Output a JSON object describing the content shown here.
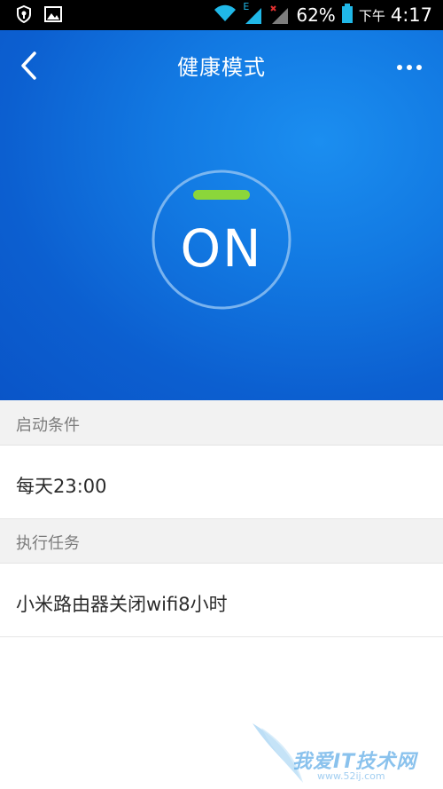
{
  "status_bar": {
    "battery": "62%",
    "period": "下午",
    "time": "4:17",
    "network_label": "E",
    "icons": [
      "shield-icon",
      "image-icon",
      "wifi-icon",
      "signal-icon",
      "signal-x-icon",
      "battery-icon"
    ]
  },
  "header": {
    "title": "健康模式",
    "back_icon": "chevron-left-icon",
    "more_icon": "more-horizontal-icon"
  },
  "toggle": {
    "state_label": "ON",
    "indicator_color": "#8bd63a"
  },
  "sections": [
    {
      "header": "启动条件",
      "item": "每天23:00"
    },
    {
      "header": "执行任务",
      "item": "小米路由器关闭wifi8小时"
    }
  ],
  "watermark": {
    "text": "我爱IT技术网",
    "sub": "www.52ij.com"
  },
  "colors": {
    "hero_blue": "#1279e2",
    "section_bg": "#f2f2f2",
    "section_text": "#7c7c7c",
    "item_text": "#2b2b2b"
  }
}
